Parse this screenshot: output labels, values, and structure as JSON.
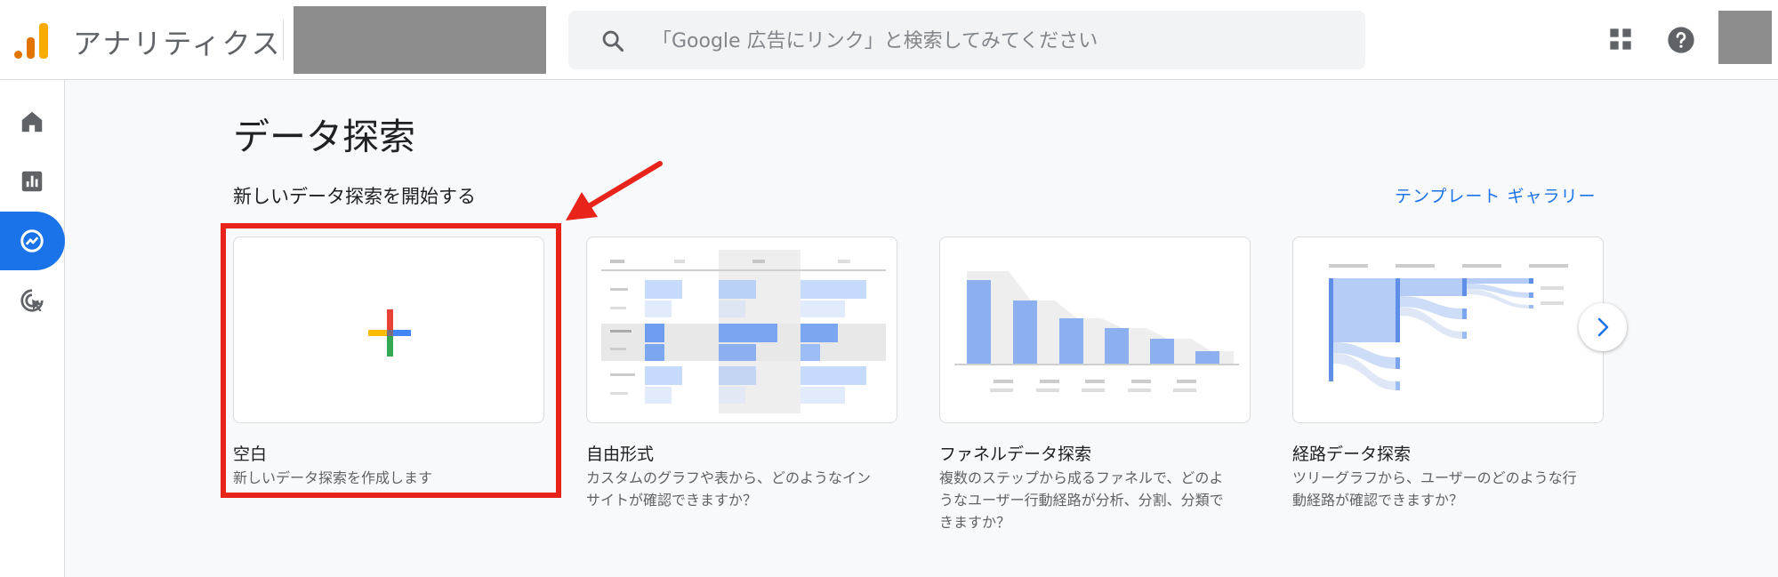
{
  "header": {
    "app_title": "アナリティクス",
    "search_placeholder": "「Google 広告にリンク」と検索してみてください"
  },
  "icons": {
    "logo": "analytics-logo-icon",
    "search": "search-icon",
    "apps": "apps-grid-icon",
    "help": "help-icon",
    "nav": [
      "home-icon",
      "reports-icon",
      "explore-icon",
      "advertising-icon"
    ],
    "next": "chevron-right-icon"
  },
  "nav": {
    "active_index": 2
  },
  "main": {
    "page_title": "データ探索",
    "section_heading": "新しいデータ探索を開始する",
    "gallery_link": "テンプレート ギャラリー",
    "cards": [
      {
        "title": "空白",
        "description": "新しいデータ探索を作成します"
      },
      {
        "title": "自由形式",
        "description": "カスタムのグラフや表から、どのようなイン\nサイトが確認できますか？"
      },
      {
        "title": "ファネルデータ探索",
        "description": "複数のステップから成るファネルで、どのよ\nうなユーザー行動経路が分析、分割、分類で\nきますか？"
      },
      {
        "title": "経路データ探索",
        "description": "ツリーグラフから、ユーザーのどのような行\n動経路が確認できますか？"
      }
    ]
  },
  "colors": {
    "accent": "#1a73e8",
    "highlight": "#e8231a",
    "logo_orange": "#e37400",
    "logo_yellow": "#f9ab00"
  }
}
